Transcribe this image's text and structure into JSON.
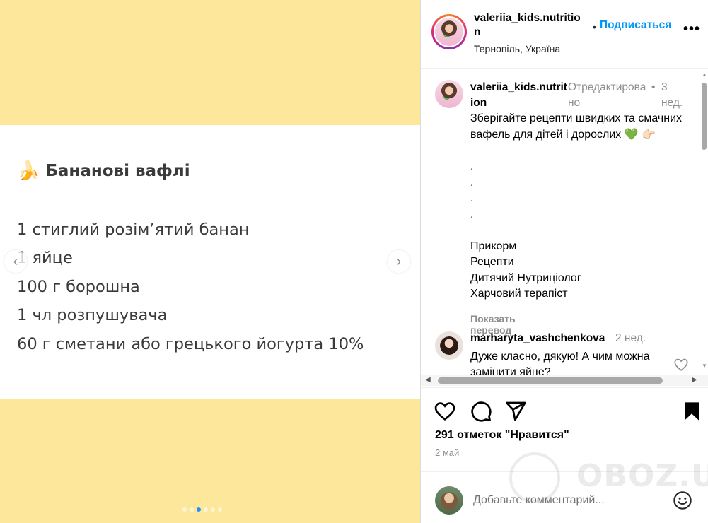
{
  "post_image": {
    "title_emoji": "🍌",
    "title": "Бананові вафлі",
    "ingredients": [
      "1 стиглий розім’ятий банан",
      "1 яйце",
      "100 г борошна",
      "1 чл розпушувача",
      "60 г сметани або грецького йогурта 10%"
    ],
    "prev_icon": "chevron-left-icon",
    "next_icon": "chevron-right-icon",
    "carousel": {
      "total": 6,
      "active_index": 2
    },
    "bg_color": "#fde79a",
    "card_color": "#ffffff"
  },
  "header": {
    "username": "valeriia_kids.nutrition",
    "separator": "•",
    "follow_label": "Подписаться",
    "location": "Тернопіль, Україна",
    "more_label": "•••"
  },
  "caption": {
    "username": "valeriia_kids.nutrition",
    "edited": "Отредактировано",
    "bullet": "•",
    "time": "3 нед.",
    "text": "Зберігайте рецепти швидких та смачних вафель для дітей і дорослих 💚 👉🏻",
    "lines": [
      ".",
      ".",
      ".",
      ".",
      "",
      "Прикорм",
      "Рецепти",
      "Дитячий Нутриціолог",
      "Харчовий терапіст"
    ],
    "translate_label": "Показать перевод"
  },
  "comments": [
    {
      "username": "marharyta_vashchenkova",
      "time": "2 нед.",
      "text": "Дуже класно, дякую! А чим можна замінити яйце?"
    }
  ],
  "actions": {
    "like_icon": "heart-icon",
    "comment_icon": "comment-icon",
    "share_icon": "share-icon",
    "save_icon": "bookmark-icon"
  },
  "likes_text": "291 отметок \"Нравится\"",
  "date": "2 май",
  "add_comment": {
    "placeholder": "Добавьте комментарий...",
    "emoji_icon": "smiley-icon"
  },
  "watermark": "OBOZ.UA",
  "accent_color": "#0095f6"
}
